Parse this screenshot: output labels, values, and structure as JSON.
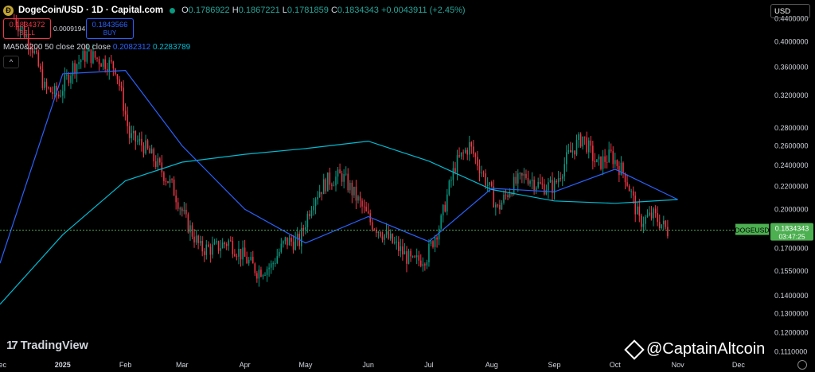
{
  "header": {
    "symbol": "DogeCoin/USD · 1D · Capital.com",
    "coin_icon": "doge-coin-icon",
    "open_label": "O",
    "open": "0.1786922",
    "high_label": "H",
    "high": "0.1867221",
    "low_label": "L",
    "low": "0.1781859",
    "close_label": "C",
    "close": "0.1834343",
    "change": "+0.0043911 (+2.45%)"
  },
  "trade": {
    "sell_price": "0.1834372",
    "sell_label": "SELL",
    "spread": "0.0009194",
    "buy_price": "0.1843566",
    "buy_label": "BUY"
  },
  "indicator": {
    "name": "MA50&200 50 close 200 close",
    "ma50": "0.2082312",
    "ma200": "0.2283789"
  },
  "currency_selector": "USD",
  "branding": {
    "tradingview": "TradingView",
    "watermark": "@CaptainAltcoin"
  },
  "colors": {
    "up": "#089981",
    "down": "#f23645",
    "ma50": "#2962ff",
    "ma200": "#00bcd4",
    "price_line": "#4caf50"
  },
  "chart_data": {
    "type": "candlestick",
    "symbol_label": "DOGEUSD",
    "last_price": "0.1834343",
    "countdown": "03:47:25",
    "y_scale": "log",
    "ylim": [
      0.109,
      0.475
    ],
    "y_ticks": [
      "0.4400000",
      "0.4000000",
      "0.3600000",
      "0.3200000",
      "0.2800000",
      "0.2600000",
      "0.2400000",
      "0.2200000",
      "0.2000000",
      "0.1834343",
      "0.1700000",
      "0.1550000",
      "0.1400000",
      "0.1300000",
      "0.1200000",
      "0.1110000"
    ],
    "x_ticks": [
      "Dec",
      "2025",
      "Feb",
      "Mar",
      "Apr",
      "May",
      "Jun",
      "Jul",
      "Aug",
      "Sep",
      "Oct",
      "Nov",
      "Dec"
    ],
    "x_range": [
      "2024-12-01",
      "2025-12-16"
    ],
    "x_tick_dates": [
      "2024-12-01",
      "2025-01-01",
      "2025-02-01",
      "2025-03-01",
      "2025-04-01",
      "2025-05-01",
      "2025-06-01",
      "2025-07-01",
      "2025-08-01",
      "2025-09-01",
      "2025-10-01",
      "2025-11-01",
      "2025-12-01"
    ],
    "closes": [
      [
        "2024-12-08",
        0.44
      ],
      [
        "2024-12-16",
        0.4
      ],
      [
        "2024-12-23",
        0.33
      ],
      [
        "2024-12-30",
        0.32
      ],
      [
        "2025-01-06",
        0.36
      ],
      [
        "2025-01-13",
        0.38
      ],
      [
        "2025-01-20",
        0.37
      ],
      [
        "2025-01-27",
        0.36
      ],
      [
        "2025-02-03",
        0.27
      ],
      [
        "2025-02-10",
        0.26
      ],
      [
        "2025-02-17",
        0.24
      ],
      [
        "2025-02-24",
        0.22
      ],
      [
        "2025-03-03",
        0.19
      ],
      [
        "2025-03-10",
        0.17
      ],
      [
        "2025-03-17",
        0.17
      ],
      [
        "2025-03-24",
        0.175
      ],
      [
        "2025-03-31",
        0.165
      ],
      [
        "2025-04-07",
        0.155
      ],
      [
        "2025-04-14",
        0.158
      ],
      [
        "2025-04-21",
        0.175
      ],
      [
        "2025-04-28",
        0.175
      ],
      [
        "2025-05-05",
        0.21
      ],
      [
        "2025-05-12",
        0.225
      ],
      [
        "2025-05-19",
        0.23
      ],
      [
        "2025-05-26",
        0.21
      ],
      [
        "2025-06-02",
        0.19
      ],
      [
        "2025-06-09",
        0.18
      ],
      [
        "2025-06-16",
        0.17
      ],
      [
        "2025-06-23",
        0.16
      ],
      [
        "2025-06-30",
        0.165
      ],
      [
        "2025-07-07",
        0.19
      ],
      [
        "2025-07-14",
        0.24
      ],
      [
        "2025-07-21",
        0.26
      ],
      [
        "2025-07-28",
        0.23
      ],
      [
        "2025-08-04",
        0.2
      ],
      [
        "2025-08-11",
        0.22
      ],
      [
        "2025-08-18",
        0.23
      ],
      [
        "2025-08-25",
        0.22
      ],
      [
        "2025-09-01",
        0.22
      ],
      [
        "2025-09-08",
        0.25
      ],
      [
        "2025-09-15",
        0.27
      ],
      [
        "2025-09-22",
        0.24
      ],
      [
        "2025-09-29",
        0.25
      ],
      [
        "2025-10-06",
        0.23
      ],
      [
        "2025-10-13",
        0.19
      ],
      [
        "2025-10-20",
        0.195
      ],
      [
        "2025-10-27",
        0.183
      ]
    ],
    "ma50": [
      [
        "2024-12-01",
        0.16
      ],
      [
        "2025-01-01",
        0.35
      ],
      [
        "2025-02-01",
        0.355
      ],
      [
        "2025-03-01",
        0.26
      ],
      [
        "2025-04-01",
        0.2
      ],
      [
        "2025-05-01",
        0.174
      ],
      [
        "2025-06-01",
        0.194
      ],
      [
        "2025-07-01",
        0.175
      ],
      [
        "2025-08-01",
        0.218
      ],
      [
        "2025-09-01",
        0.215
      ],
      [
        "2025-10-01",
        0.236
      ],
      [
        "2025-11-01",
        0.2082312
      ]
    ],
    "ma200": [
      [
        "2024-12-01",
        0.135
      ],
      [
        "2025-01-01",
        0.18
      ],
      [
        "2025-02-01",
        0.225
      ],
      [
        "2025-03-01",
        0.243
      ],
      [
        "2025-04-01",
        0.251
      ],
      [
        "2025-05-01",
        0.257
      ],
      [
        "2025-06-01",
        0.265
      ],
      [
        "2025-07-01",
        0.244
      ],
      [
        "2025-08-01",
        0.217
      ],
      [
        "2025-09-01",
        0.207
      ],
      [
        "2025-10-01",
        0.205
      ],
      [
        "2025-11-01",
        0.2082312
      ]
    ],
    "ma_names": [
      "MA50",
      "MA200"
    ]
  }
}
